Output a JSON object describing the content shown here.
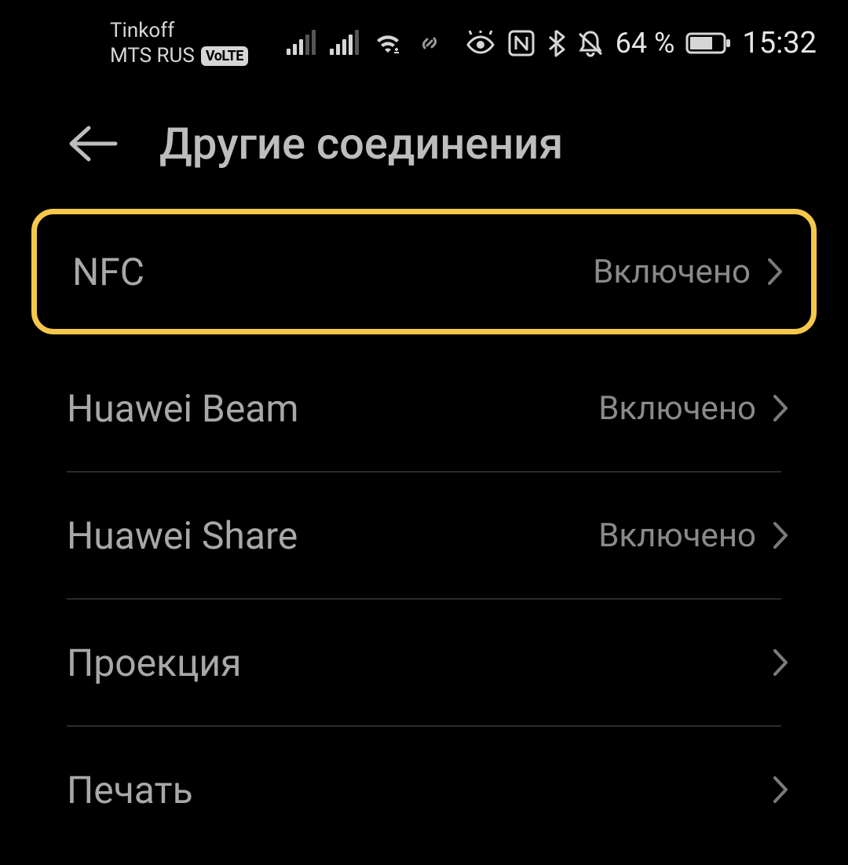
{
  "status_bar": {
    "carrier_line1": "Tinkoff",
    "carrier_line2": "MTS RUS",
    "volte": "VoLTE",
    "battery_percent": "64 %",
    "time": "15:32"
  },
  "header": {
    "title": "Другие соединения"
  },
  "settings": [
    {
      "label": "NFC",
      "value": "Включено",
      "highlighted": true
    },
    {
      "label": "Huawei Beam",
      "value": "Включено",
      "highlighted": false
    },
    {
      "label": "Huawei Share",
      "value": "Включено",
      "highlighted": false
    },
    {
      "label": "Проекция",
      "value": "",
      "highlighted": false
    },
    {
      "label": "Печать",
      "value": "",
      "highlighted": false
    }
  ]
}
